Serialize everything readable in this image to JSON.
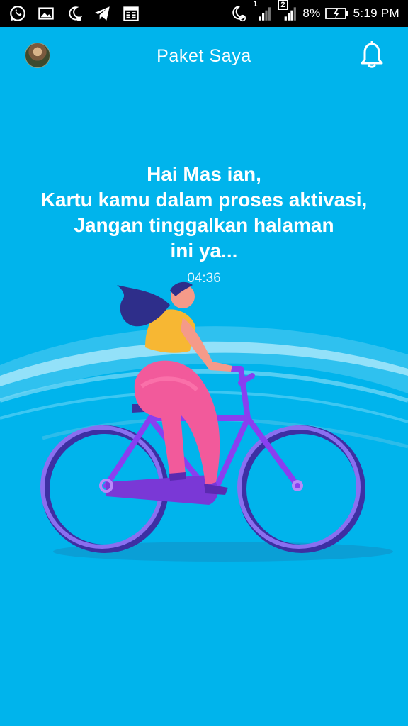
{
  "status_bar": {
    "sim1": "1",
    "sim2": "2",
    "battery": "8%",
    "time": "5:19 PM",
    "icons": [
      "whatsapp-icon",
      "gallery-icon",
      "dnd-moon-icon",
      "telegram-icon",
      "calendar-icon",
      "moon-alarm-icon",
      "signal-icon",
      "battery-icon"
    ]
  },
  "header": {
    "title": "Paket Saya",
    "left_icon": "avatar",
    "right_icon": "bell-icon"
  },
  "message": {
    "line1": "Hai Mas ian,",
    "line2": "Kartu kamu dalam proses aktivasi,",
    "line3": "Jangan tinggalkan halaman",
    "line4": "ini ya..."
  },
  "timer": "04:36",
  "colors": {
    "background": "#00b4ec",
    "status_bar": "#000000",
    "text": "#ffffff"
  }
}
